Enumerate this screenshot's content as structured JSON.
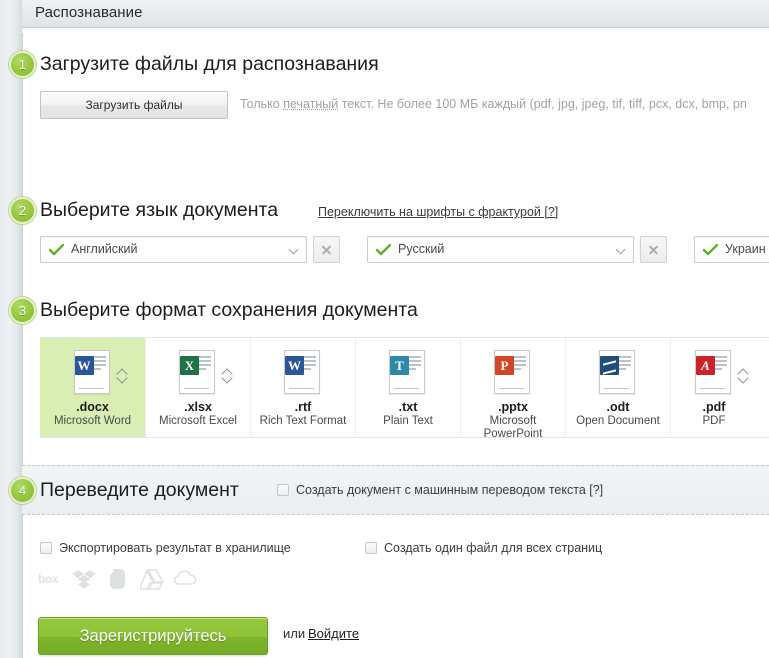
{
  "header": {
    "title": "Распознавание"
  },
  "steps": {
    "one": "1",
    "two": "2",
    "three": "3",
    "four": "4"
  },
  "section1": {
    "heading": "Загрузите файлы для распознавания",
    "upload_button": "Загрузить файлы",
    "hint_prefix": "Только ",
    "hint_underlined": "печатный",
    "hint_suffix": " текст. Не более 100 МБ каждый (pdf, jpg, jpeg, tif, tiff, pcx, dcx, bmp, pn"
  },
  "section2": {
    "heading": "Выберите язык документа",
    "fraktur_link": "Переключить на шрифты с фрактурой [?]",
    "languages": [
      {
        "value": "Английский",
        "remove": "×"
      },
      {
        "value": "Русский",
        "remove": "×"
      },
      {
        "value": "Украин",
        "remove": "×"
      }
    ]
  },
  "section3": {
    "heading": "Выберите формат сохранения документа",
    "formats": [
      {
        "ext": ".docx",
        "name": "Microsoft Word",
        "icon": "word-doc-icon",
        "glyph": "W",
        "color": "#2a5699",
        "selected": true,
        "spinner": true
      },
      {
        "ext": ".xlsx",
        "name": "Microsoft Excel",
        "icon": "excel-doc-icon",
        "glyph": "X",
        "color": "#1f7244",
        "selected": false,
        "spinner": true
      },
      {
        "ext": ".rtf",
        "name": "Rich Text Format",
        "icon": "rtf-doc-icon",
        "glyph": "W",
        "color": "#2a5699",
        "selected": false,
        "spinner": false
      },
      {
        "ext": ".txt",
        "name": "Plain Text",
        "icon": "plain-text-doc-icon",
        "glyph": "T",
        "color": "#2c8aa8",
        "selected": false,
        "spinner": false
      },
      {
        "ext": ".pptx",
        "name": "Microsoft PowerPoint",
        "icon": "powerpoint-doc-icon",
        "glyph": "P",
        "color": "#d24625",
        "selected": false,
        "spinner": false
      },
      {
        "ext": ".odt",
        "name": "Open Document",
        "icon": "opendocument-icon",
        "glyph": "",
        "color": "#1f4e79",
        "selected": false,
        "spinner": false
      },
      {
        "ext": ".pdf",
        "name": "PDF",
        "icon": "pdf-doc-icon",
        "glyph": "A",
        "color": "#cc2229",
        "selected": false,
        "spinner": true
      }
    ]
  },
  "section4": {
    "heading": "Переведите документ",
    "machine_translation_label": "Создать документ с машинным переводом текста [?]",
    "export_label": "Экспортировать результат в хранилище",
    "single_file_label": "Создать один файл для всех страниц",
    "storages": [
      {
        "icon": "box-storage-icon",
        "label": "box"
      },
      {
        "icon": "dropbox-storage-icon",
        "label": ""
      },
      {
        "icon": "evernote-storage-icon",
        "label": ""
      },
      {
        "icon": "googledrive-storage-icon",
        "label": ""
      },
      {
        "icon": "onedrive-storage-icon",
        "label": ""
      }
    ]
  },
  "footer": {
    "register_button": "Зарегистрируйтесь",
    "or_text": "или",
    "login_link": "Войдите"
  },
  "colors": {
    "accent_green": "#8ec337",
    "step_badge": "#9acb43",
    "selected_tile": "#d9eeb2",
    "hint_grey": "#9ea4a8"
  }
}
